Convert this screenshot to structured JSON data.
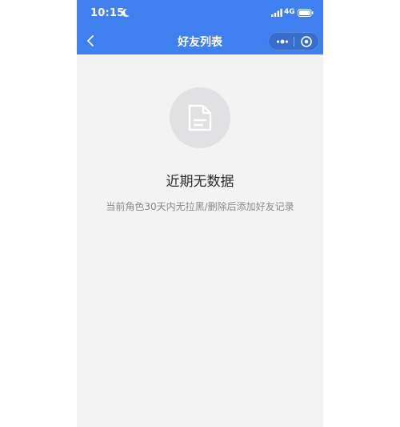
{
  "status_bar": {
    "time": "10:15",
    "network": "4G",
    "icons": [
      "moon-icon",
      "signal-icon",
      "battery-icon"
    ]
  },
  "nav": {
    "title": "好友列表",
    "icons": [
      "back-icon",
      "more-icon",
      "close-icon"
    ]
  },
  "empty_state": {
    "title": "近期无数据",
    "description": "当前角色30天内无拉黑/删除后添加好友记录",
    "icon": "document-icon"
  },
  "colors": {
    "nav_background": "#3f7ff0",
    "page_background": "#f3f3f4",
    "icon_circle": "#e1e1e3",
    "title_text": "#2b2b2b",
    "description_text": "#8a8a8a"
  }
}
